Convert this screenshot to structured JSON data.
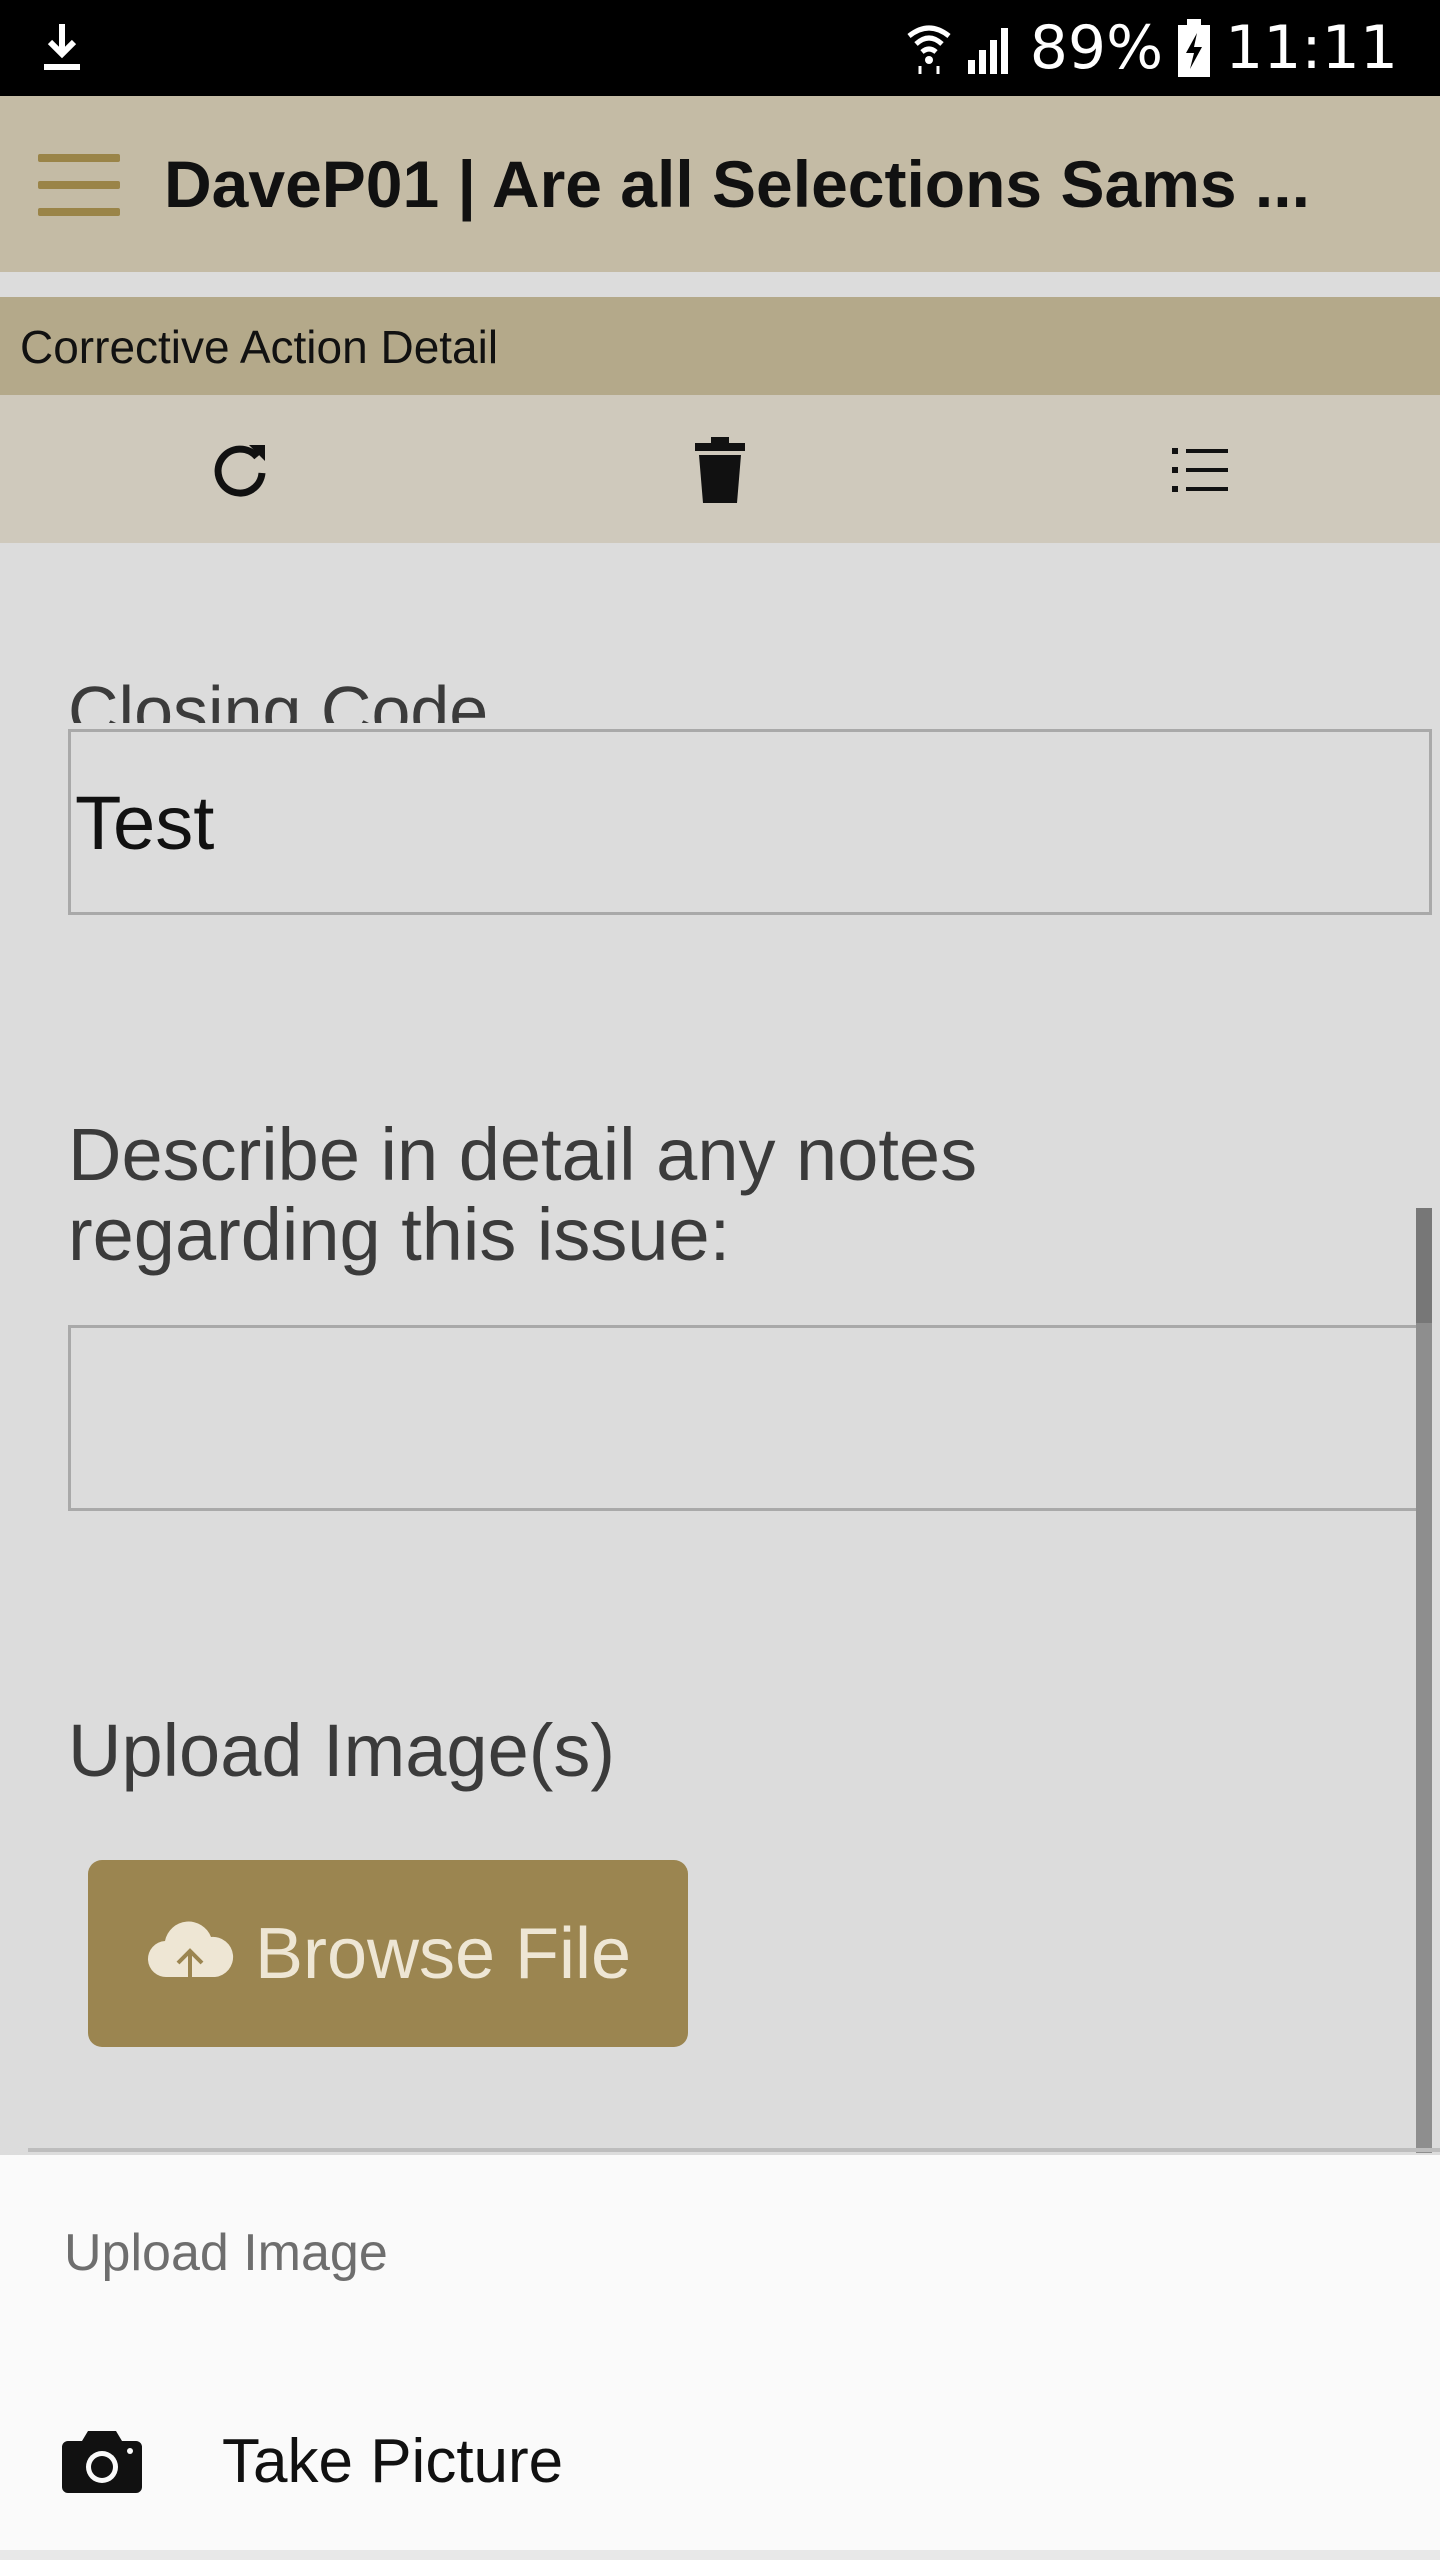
{
  "status_bar": {
    "battery": "89%",
    "time": "11:11",
    "icons": [
      "download-icon",
      "wifi-icon",
      "signal-icon",
      "battery-charging-icon"
    ]
  },
  "app_bar": {
    "title": "DaveP01 | Are all Selections Sams ...",
    "menu_icon": "hamburger-menu-icon",
    "accent_color": "#9a8448"
  },
  "section": {
    "title": "Corrective Action Detail"
  },
  "toolbar": {
    "icons": [
      "refresh-icon",
      "trash-icon",
      "list-icon"
    ]
  },
  "form": {
    "partial_label": "Closing Code",
    "closing_value": "Test",
    "notes_label": "Describe in detail any notes regarding this issue:",
    "notes_value": "",
    "upload_label": "Upload Image(s)",
    "browse_label": "Browse File",
    "browse_color": "#9b8550"
  },
  "sheet": {
    "title": "Upload Image",
    "items": [
      {
        "label": "Take Picture",
        "icon": "camera-icon"
      }
    ]
  }
}
